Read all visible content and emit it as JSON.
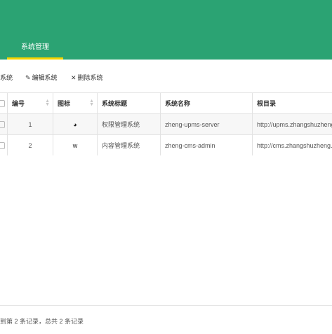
{
  "header": {
    "tabs": [
      {
        "label": "系统管理",
        "active": true
      }
    ],
    "accent_color": "#2ba373",
    "tab_indicator_color": "#f5d400"
  },
  "toolbar": {
    "add_label": "系统",
    "edit_label": "编辑系统",
    "delete_label": "删除系统"
  },
  "table": {
    "columns": [
      "编号",
      "图标",
      "系统标题",
      "系统名称",
      "根目录"
    ],
    "rows": [
      {
        "id": "1",
        "icon": "globe-icon",
        "icon_glyph": "◕",
        "title": "权限管理系统",
        "name": "zheng-upms-server",
        "root": "http://upms.zhangshuzheng.cn"
      },
      {
        "id": "2",
        "icon": "wordpress-icon",
        "icon_glyph": "w",
        "title": "内容管理系统",
        "name": "zheng-cms-admin",
        "root": "http://cms.zhangshuzheng.cn"
      }
    ]
  },
  "footer": {
    "summary": "到第 2 条记录，总共 2 条记录"
  }
}
